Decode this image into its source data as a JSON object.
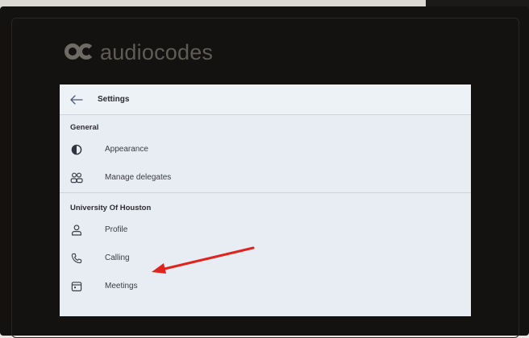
{
  "brand": {
    "logo_text": "audiocodes"
  },
  "settings": {
    "title": "Settings",
    "sections": [
      {
        "title": "General",
        "items": [
          {
            "label": "Appearance",
            "icon": "contrast-icon"
          },
          {
            "label": "Manage delegates",
            "icon": "people-icon"
          }
        ]
      },
      {
        "title": "University Of Houston",
        "items": [
          {
            "label": "Profile",
            "icon": "person-icon"
          },
          {
            "label": "Calling",
            "icon": "phone-icon"
          },
          {
            "label": "Meetings",
            "icon": "calendar-icon"
          }
        ]
      }
    ]
  },
  "annotation": {
    "arrow_color": "#e0231c",
    "points_to": "Calling"
  },
  "colors": {
    "screen_background": "#e7edf2",
    "device_bezel": "#141210",
    "logo": "#5f5b57"
  }
}
